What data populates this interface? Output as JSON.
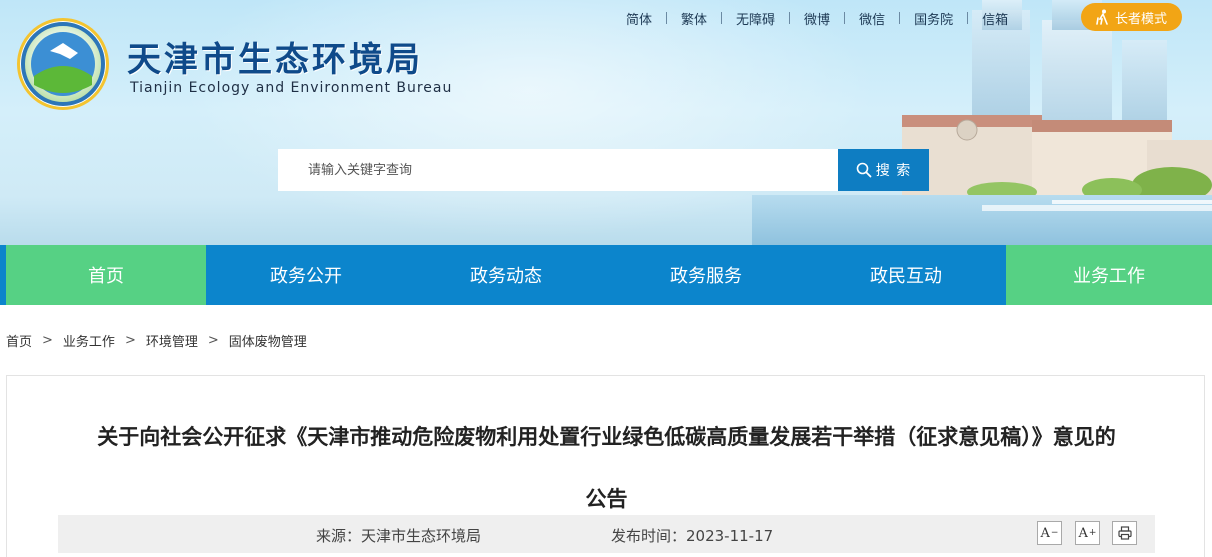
{
  "header": {
    "title": "天津市生态环境局",
    "subtitle": "Tianjin Ecology and Environment Bureau",
    "logo_ring_text": "TIANJIN ECOLOGY ENVIRONMENT",
    "logo_bottom_text": "天津生态环境",
    "top_links": [
      "简体",
      "繁体",
      "无障碍",
      "微博",
      "微信",
      "国务院",
      "信箱"
    ],
    "elder_mode_label": "长者模式",
    "search": {
      "placeholder": "请输入关键字查询",
      "button_label": "搜 索"
    }
  },
  "nav": {
    "items": [
      "首页",
      "政务公开",
      "政务动态",
      "政务服务",
      "政民互动",
      "业务工作"
    ]
  },
  "breadcrumb": [
    "首页",
    "业务工作",
    "环境管理",
    "固体废物管理"
  ],
  "article": {
    "title_line1": "关于向社会公开征求《天津市推动危险废物利用处置行业绿色低碳高质量发展若干举措（征求意见稿）》意见的",
    "title_line2": "公告",
    "source": "来源：天津市生态环境局",
    "publish_time": "发布时间：2023-11-17",
    "font_smaller_label": "A",
    "font_larger_label": "A"
  },
  "colors": {
    "nav_blue": "#0c85cc",
    "nav_green": "#56d184",
    "search_button": "#0e7dc2",
    "elder_button": "#f2a515",
    "title_blue": "#0f4a8a"
  }
}
